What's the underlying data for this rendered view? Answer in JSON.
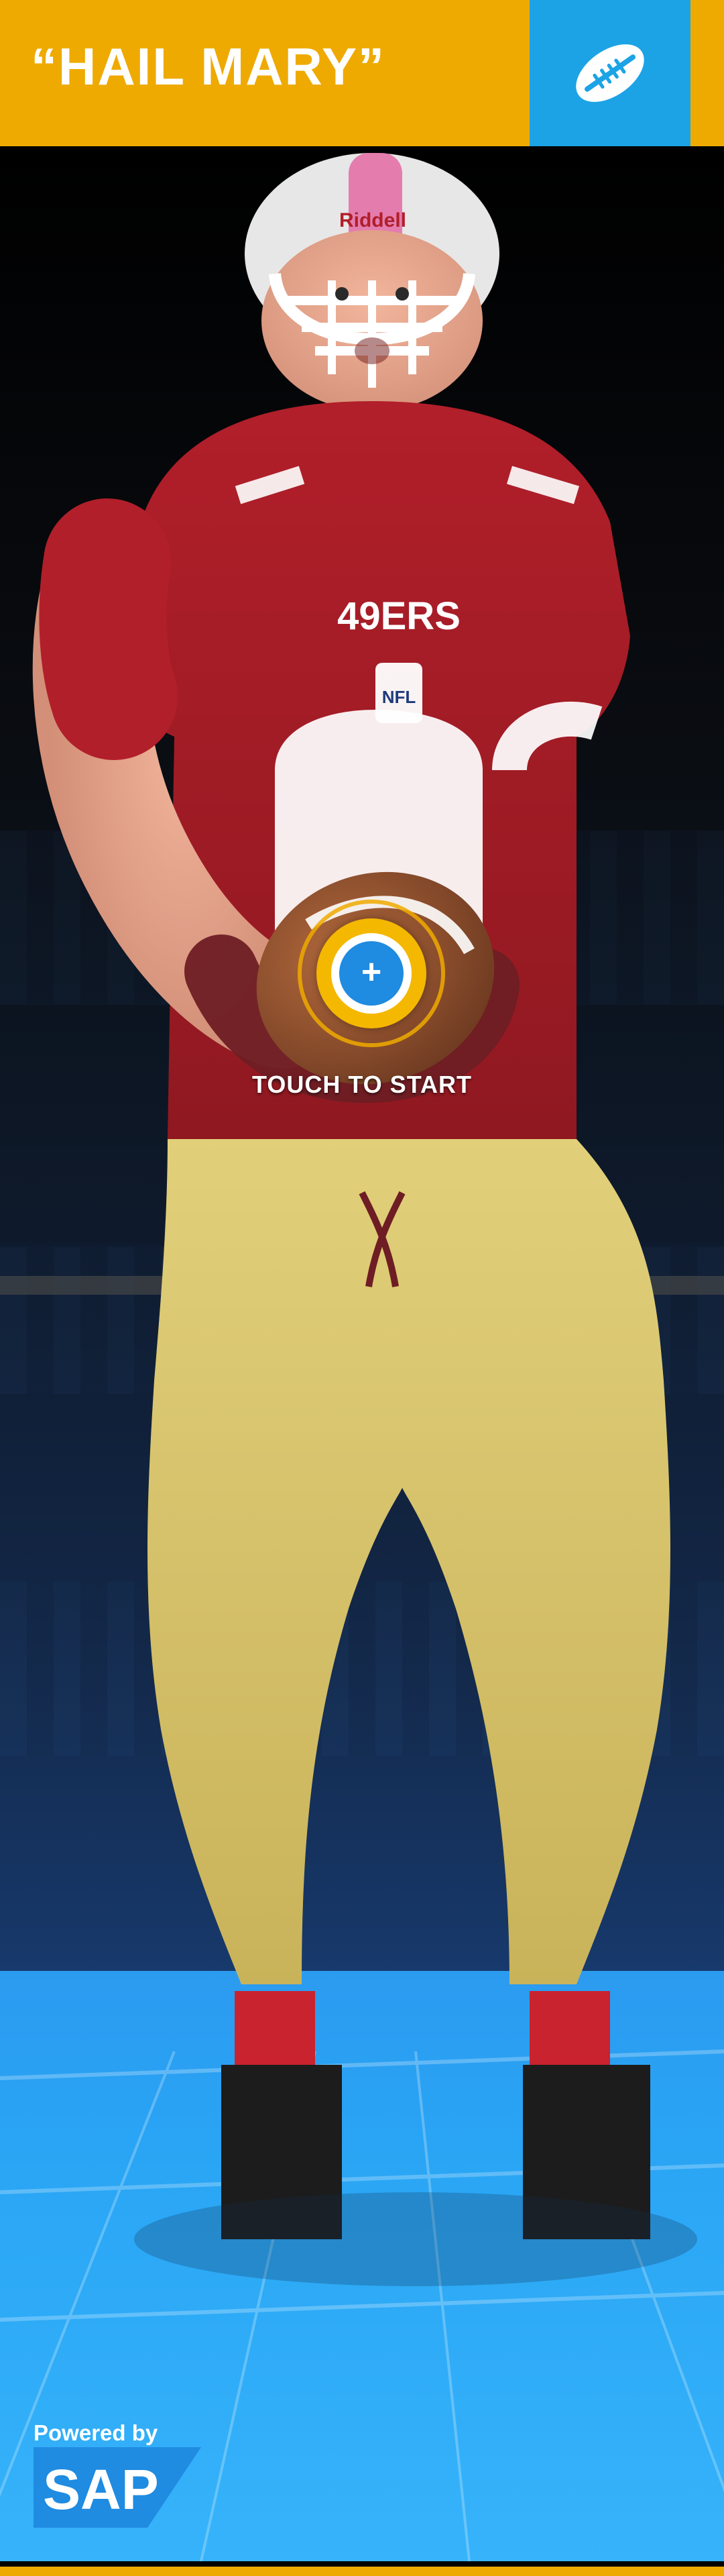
{
  "header": {
    "title": "“HAIL MARY”",
    "icon": "football-icon",
    "colors": {
      "header_bg": "#eeaa00",
      "icon_box_bg": "#1ca3e6"
    }
  },
  "scene": {
    "player_branding": {
      "helmet_brand": "Riddell",
      "team_text": "49ERS",
      "nfl_shield": "NFL"
    }
  },
  "cta": {
    "label": "TOUCH TO START",
    "icon": "plus-icon",
    "accent": "#1f8be1",
    "ring": "#f4b800"
  },
  "footer": {
    "powered_by": "Powered by",
    "brand": "SAP",
    "brand_colors": {
      "logo_blue": "#1f8be1"
    },
    "bottom_bar": "#eeaa00"
  }
}
